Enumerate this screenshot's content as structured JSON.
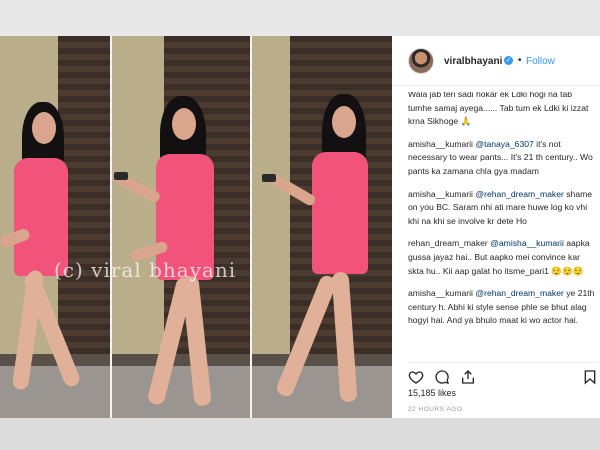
{
  "photo": {
    "watermark": "(c) viral bhayani"
  },
  "post": {
    "username": "viralbhayani",
    "verified_icon": "verified-badge-icon",
    "separator": "•",
    "follow_label": "Follow",
    "comments": [
      {
        "author": "",
        "text": "Wala jab teri sadi hokar ek Ldki hogi na tab tumhe samaj ayega...... Tab tum ek Ldki ki izzat krna Sikhoge 🙏"
      },
      {
        "author": "amisha__kumarii",
        "mention": "@tanaya_6307",
        "text": " it's not necessary to wear pants... It's 21 th century.. Wo pants ka zamana chla gya madam"
      },
      {
        "author": "amisha__kumarii",
        "mention": "@rehan_dream_maker",
        "text": " shame on you BC. Saram nhi ati mare huwe log ko vhi khi na khi se involve kr dete Ho"
      },
      {
        "author": "rehan_dream_maker",
        "mention": "@amisha__kumarii",
        "text": " aapka gussa jayaz hai.. But aapko mei convince kar skta hu.. Kii aap galat ho itsme_pari1 😌😌😌"
      },
      {
        "author": "amisha__kumarii",
        "mention": "@rehan_dream_maker",
        "text": " ye 21th century h. Abhi ki style sense phle se bhut alag hogyi hai. And ya bhulo maat ki wo actor hai."
      }
    ],
    "likes": "15,185 likes",
    "timestamp": "22 HOURS AGO",
    "icons": [
      "heart-icon",
      "comment-icon",
      "share-icon",
      "bookmark-icon"
    ]
  }
}
